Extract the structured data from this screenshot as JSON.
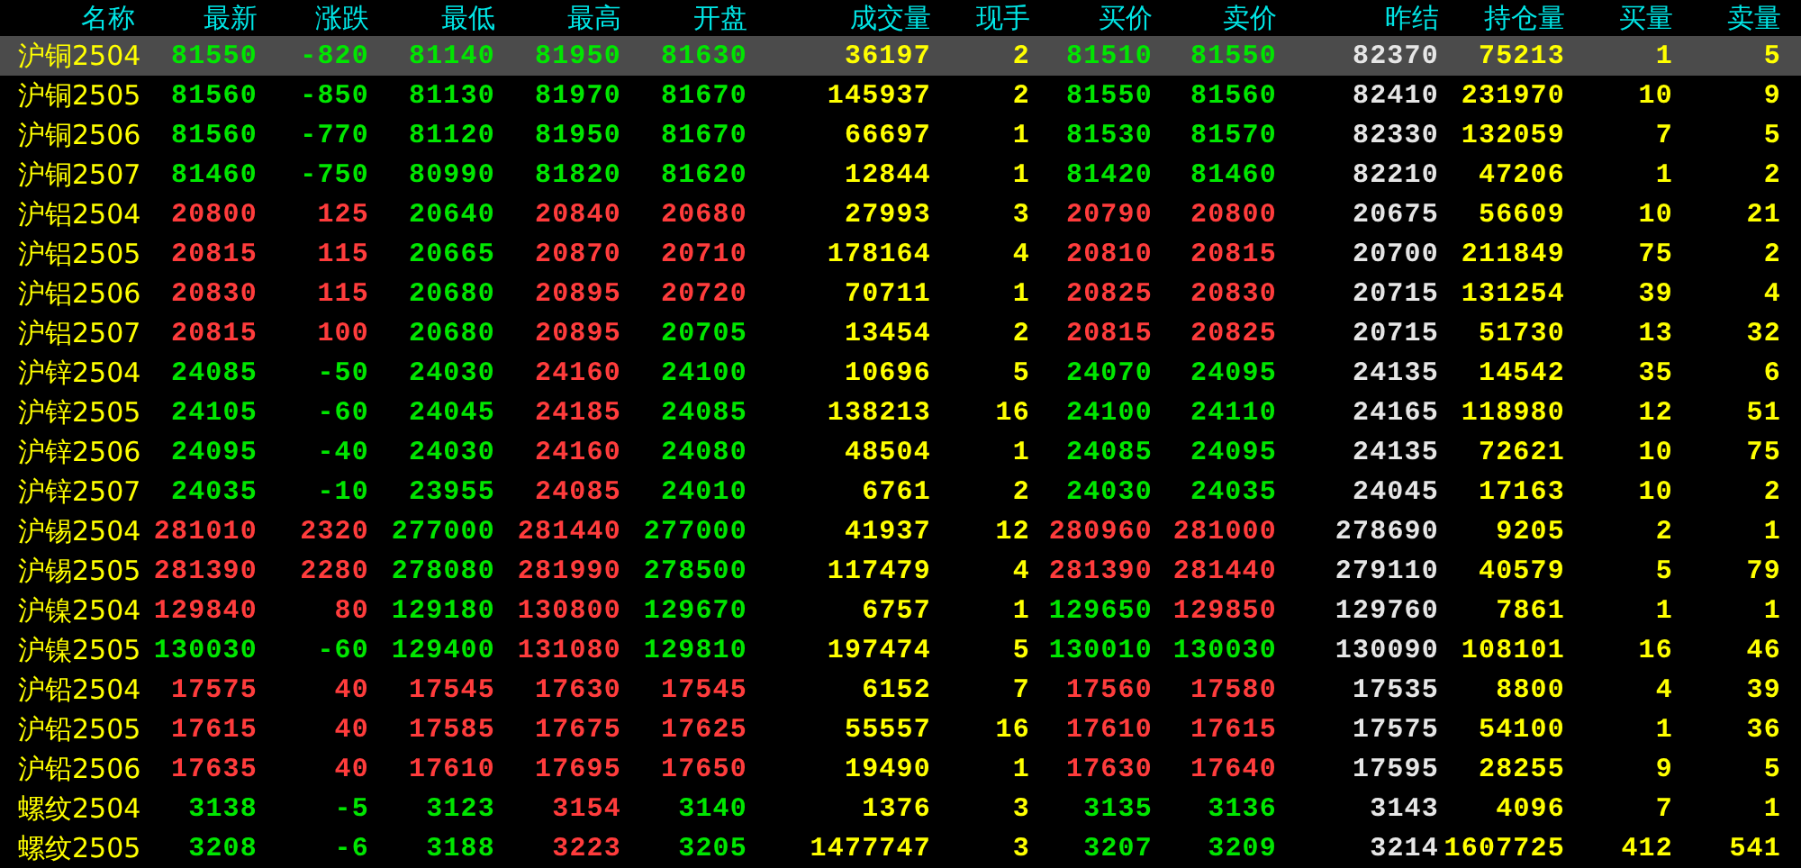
{
  "columns": [
    {
      "label": "名称",
      "kind": "name"
    },
    {
      "label": "最新",
      "kind": "price"
    },
    {
      "label": "涨跌",
      "kind": "change"
    },
    {
      "label": "最低",
      "kind": "price"
    },
    {
      "label": "最高",
      "kind": "price"
    },
    {
      "label": "开盘",
      "kind": "price"
    },
    {
      "label": "成交量",
      "kind": "volume"
    },
    {
      "label": "现手",
      "kind": "volume"
    },
    {
      "label": "买价",
      "kind": "price"
    },
    {
      "label": "卖价",
      "kind": "price"
    },
    {
      "label": "昨结",
      "kind": "prev"
    },
    {
      "label": "持仓量",
      "kind": "volume"
    },
    {
      "label": "买量",
      "kind": "volume"
    },
    {
      "label": "卖量",
      "kind": "volume"
    }
  ],
  "rows": [
    {
      "selected": true,
      "cells": [
        "沪铜2504",
        "81550",
        "-820",
        "81140",
        "81950",
        "81630",
        "36197",
        "2",
        "81510",
        "81550",
        "82370",
        "75213",
        "1",
        "5"
      ]
    },
    {
      "selected": false,
      "cells": [
        "沪铜2505",
        "81560",
        "-850",
        "81130",
        "81970",
        "81670",
        "145937",
        "2",
        "81550",
        "81560",
        "82410",
        "231970",
        "10",
        "9"
      ]
    },
    {
      "selected": false,
      "cells": [
        "沪铜2506",
        "81560",
        "-770",
        "81120",
        "81950",
        "81670",
        "66697",
        "1",
        "81530",
        "81570",
        "82330",
        "132059",
        "7",
        "5"
      ]
    },
    {
      "selected": false,
      "cells": [
        "沪铜2507",
        "81460",
        "-750",
        "80990",
        "81820",
        "81620",
        "12844",
        "1",
        "81420",
        "81460",
        "82210",
        "47206",
        "1",
        "2"
      ]
    },
    {
      "selected": false,
      "cells": [
        "沪铝2504",
        "20800",
        "125",
        "20640",
        "20840",
        "20680",
        "27993",
        "3",
        "20790",
        "20800",
        "20675",
        "56609",
        "10",
        "21"
      ]
    },
    {
      "selected": false,
      "cells": [
        "沪铝2505",
        "20815",
        "115",
        "20665",
        "20870",
        "20710",
        "178164",
        "4",
        "20810",
        "20815",
        "20700",
        "211849",
        "75",
        "2"
      ]
    },
    {
      "selected": false,
      "cells": [
        "沪铝2506",
        "20830",
        "115",
        "20680",
        "20895",
        "20720",
        "70711",
        "1",
        "20825",
        "20830",
        "20715",
        "131254",
        "39",
        "4"
      ]
    },
    {
      "selected": false,
      "cells": [
        "沪铝2507",
        "20815",
        "100",
        "20680",
        "20895",
        "20705",
        "13454",
        "2",
        "20815",
        "20825",
        "20715",
        "51730",
        "13",
        "32"
      ]
    },
    {
      "selected": false,
      "cells": [
        "沪锌2504",
        "24085",
        "-50",
        "24030",
        "24160",
        "24100",
        "10696",
        "5",
        "24070",
        "24095",
        "24135",
        "14542",
        "35",
        "6"
      ]
    },
    {
      "selected": false,
      "cells": [
        "沪锌2505",
        "24105",
        "-60",
        "24045",
        "24185",
        "24085",
        "138213",
        "16",
        "24100",
        "24110",
        "24165",
        "118980",
        "12",
        "51"
      ]
    },
    {
      "selected": false,
      "cells": [
        "沪锌2506",
        "24095",
        "-40",
        "24030",
        "24160",
        "24080",
        "48504",
        "1",
        "24085",
        "24095",
        "24135",
        "72621",
        "10",
        "75"
      ]
    },
    {
      "selected": false,
      "cells": [
        "沪锌2507",
        "24035",
        "-10",
        "23955",
        "24085",
        "24010",
        "6761",
        "2",
        "24030",
        "24035",
        "24045",
        "17163",
        "10",
        "2"
      ]
    },
    {
      "selected": false,
      "cells": [
        "沪锡2504",
        "281010",
        "2320",
        "277000",
        "281440",
        "277000",
        "41937",
        "12",
        "280960",
        "281000",
        "278690",
        "9205",
        "2",
        "1"
      ]
    },
    {
      "selected": false,
      "cells": [
        "沪锡2505",
        "281390",
        "2280",
        "278080",
        "281990",
        "278500",
        "117479",
        "4",
        "281390",
        "281440",
        "279110",
        "40579",
        "5",
        "79"
      ]
    },
    {
      "selected": false,
      "cells": [
        "沪镍2504",
        "129840",
        "80",
        "129180",
        "130800",
        "129670",
        "6757",
        "1",
        "129650",
        "129850",
        "129760",
        "7861",
        "1",
        "1"
      ]
    },
    {
      "selected": false,
      "cells": [
        "沪镍2505",
        "130030",
        "-60",
        "129400",
        "131080",
        "129810",
        "197474",
        "5",
        "130010",
        "130030",
        "130090",
        "108101",
        "16",
        "46"
      ]
    },
    {
      "selected": false,
      "cells": [
        "沪铅2504",
        "17575",
        "40",
        "17545",
        "17630",
        "17545",
        "6152",
        "7",
        "17560",
        "17580",
        "17535",
        "8800",
        "4",
        "39"
      ]
    },
    {
      "selected": false,
      "cells": [
        "沪铅2505",
        "17615",
        "40",
        "17585",
        "17675",
        "17625",
        "55557",
        "16",
        "17610",
        "17615",
        "17575",
        "54100",
        "1",
        "36"
      ]
    },
    {
      "selected": false,
      "cells": [
        "沪铅2506",
        "17635",
        "40",
        "17610",
        "17695",
        "17650",
        "19490",
        "1",
        "17630",
        "17640",
        "17595",
        "28255",
        "9",
        "5"
      ]
    },
    {
      "selected": false,
      "cells": [
        "螺纹2504",
        "3138",
        "-5",
        "3123",
        "3154",
        "3140",
        "1376",
        "3",
        "3135",
        "3136",
        "3143",
        "4096",
        "7",
        "1"
      ]
    },
    {
      "selected": false,
      "cells": [
        "螺纹2505",
        "3208",
        "-6",
        "3188",
        "3223",
        "3205",
        "1477747",
        "3",
        "3207",
        "3209",
        "3214",
        "1607725",
        "412",
        "541"
      ]
    }
  ]
}
